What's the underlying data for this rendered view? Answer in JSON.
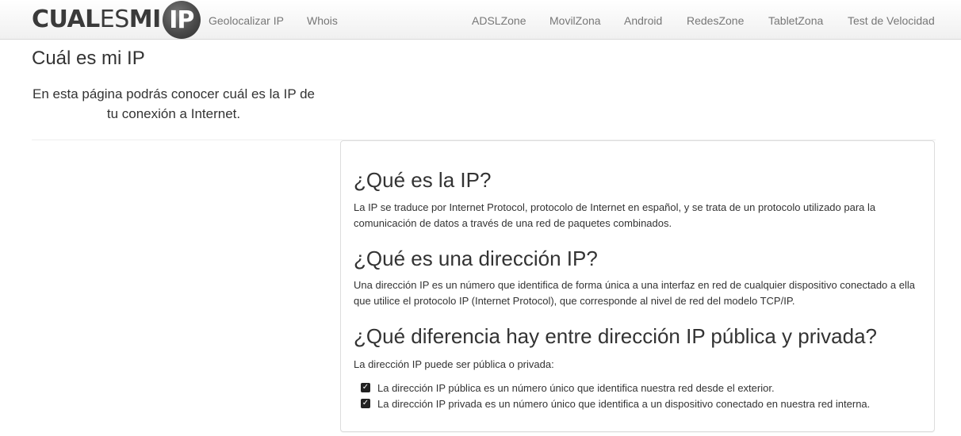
{
  "brand": {
    "part1": "CUAL",
    "part2": "ES",
    "part3": "MI",
    "badge": "IP"
  },
  "nav": {
    "left": [
      "Geolocalizar IP",
      "Whois"
    ],
    "right": [
      "ADSLZone",
      "MovilZona",
      "Android",
      "RedesZone",
      "TabletZona",
      "Test de Velocidad"
    ]
  },
  "header": {
    "title": "Cuál es mi IP",
    "intro": "En esta página podrás conocer cuál es la IP de tu conexión a Internet."
  },
  "sections": [
    {
      "heading": "¿Qué es la IP?",
      "body": "La IP se traduce por Internet Protocol, protocolo de Internet en español, y se trata de un protocolo utilizado para la comunicación de datos a través de una red de paquetes combinados."
    },
    {
      "heading": "¿Qué es una dirección IP?",
      "body": "Una dirección IP es un número que identifica de forma única a una interfaz en red de cualquier dispositivo conectado a ella que utilice el protocolo IP (Internet Protocol), que corresponde al nivel de red del modelo TCP/IP."
    },
    {
      "heading": "¿Qué diferencia hay entre dirección IP pública y privada?",
      "body": "La dirección IP puede ser pública o privada:",
      "items": [
        "La dirección IP pública es un número único que identifica nuestra red desde el exterior.",
        "La dirección IP privada es un número único que identifica a un dispositivo conectado en nuestra red interna."
      ]
    }
  ],
  "icons": {
    "check": "check-square-icon"
  }
}
